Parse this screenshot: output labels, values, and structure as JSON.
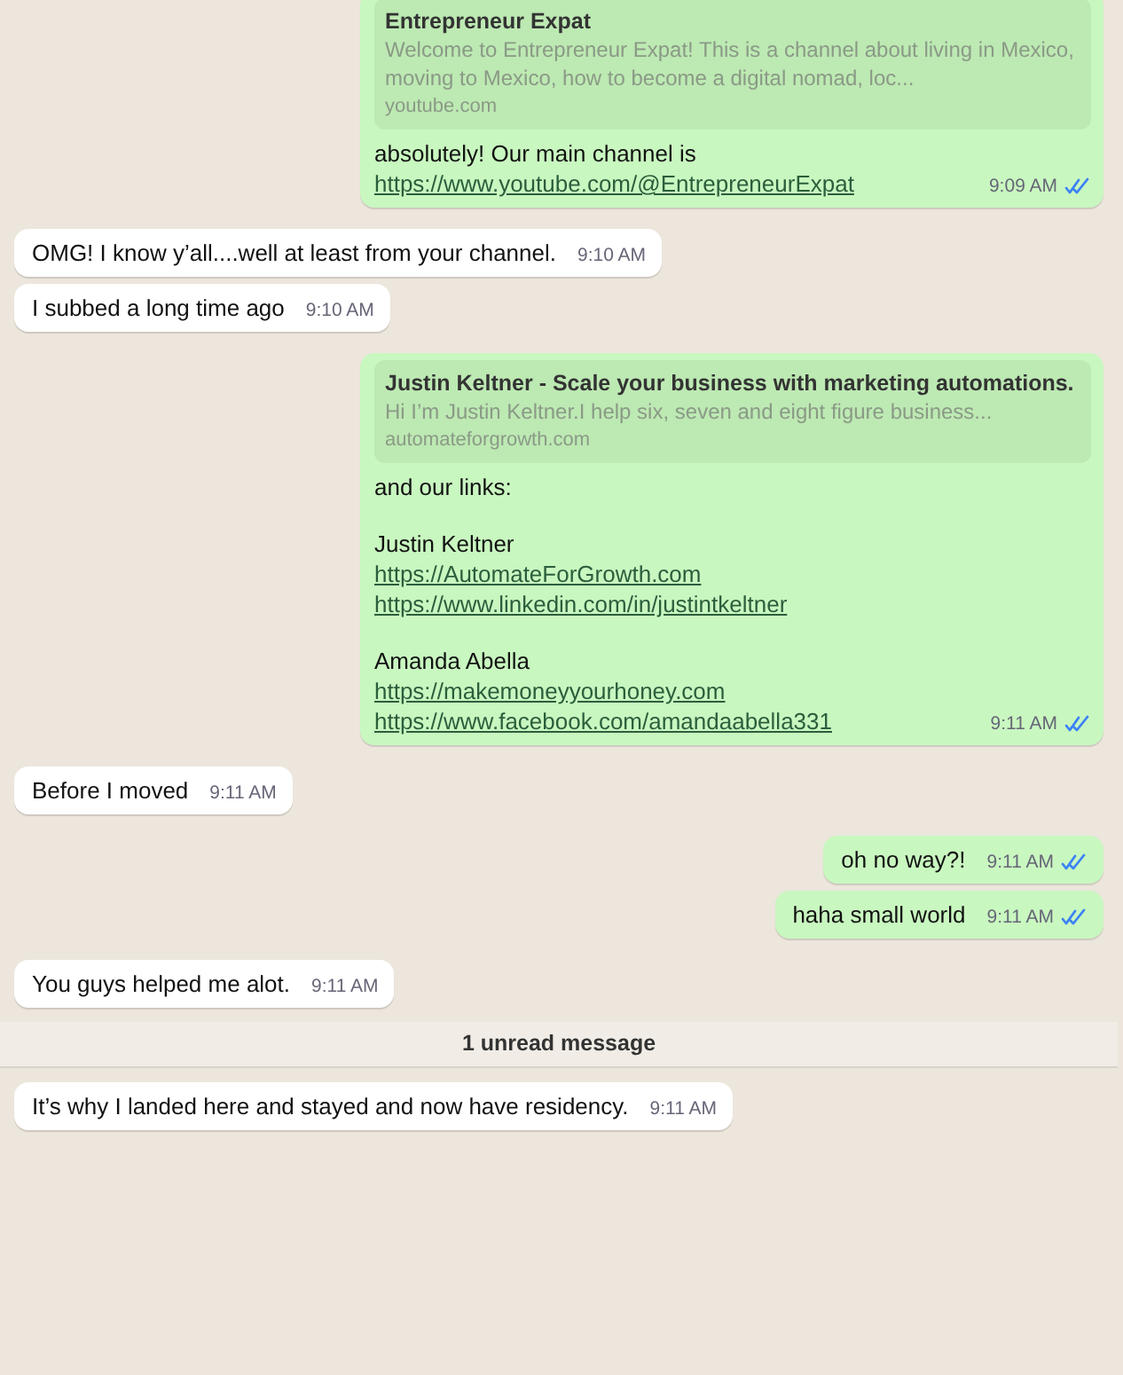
{
  "messages": [
    {
      "kind": "outgoing",
      "preview": {
        "title": "Entrepreneur Expat",
        "description": "Welcome to Entrepreneur Expat! This is a channel about living in Mexico, moving to Mexico, how to become a digital nomad, loc...",
        "domain": "youtube.com"
      },
      "paragraphs": [
        [
          {
            "kind": "text",
            "text": "absolutely! Our main channel is "
          },
          {
            "kind": "link",
            "text": "https://www.youtube.com/@EntrepreneurExpat"
          }
        ]
      ],
      "time": "9:09 AM",
      "read": true
    },
    {
      "kind": "incoming",
      "paragraphs": [
        [
          {
            "kind": "text",
            "text": "OMG! I know y’all....well at least from your channel."
          }
        ]
      ],
      "time": "9:10 AM"
    },
    {
      "kind": "incoming",
      "paragraphs": [
        [
          {
            "kind": "text",
            "text": "I subbed a long time ago"
          }
        ]
      ],
      "time": "9:10 AM"
    },
    {
      "kind": "outgoing",
      "preview": {
        "title": "Justin Keltner - Scale your business with marketing automations.",
        "description": "Hi I’m Justin Keltner.I help six, seven and eight figure business...",
        "domain": "automateforgrowth.com"
      },
      "paragraphs": [
        [
          {
            "kind": "text",
            "text": "and our links:"
          }
        ],
        [
          {
            "kind": "text",
            "text": "Justin Keltner"
          },
          {
            "kind": "link",
            "text": "https://AutomateForGrowth.com"
          },
          {
            "kind": "link",
            "text": "https://www.linkedin.com/in/justintkeltner"
          }
        ],
        [
          {
            "kind": "text",
            "text": "Amanda Abella"
          },
          {
            "kind": "link",
            "text": "https://makemoneyyourhoney.com"
          },
          {
            "kind": "link",
            "text": "https://www.facebook.com/amandaabella331"
          }
        ]
      ],
      "time": "9:11 AM",
      "read": true
    },
    {
      "kind": "incoming",
      "paragraphs": [
        [
          {
            "kind": "text",
            "text": "Before I moved"
          }
        ]
      ],
      "time": "9:11 AM"
    },
    {
      "kind": "outgoing",
      "paragraphs": [
        [
          {
            "kind": "text",
            "text": "oh no way?!"
          }
        ]
      ],
      "time": "9:11 AM",
      "read": true
    },
    {
      "kind": "outgoing",
      "paragraphs": [
        [
          {
            "kind": "text",
            "text": "haha small world"
          }
        ]
      ],
      "time": "9:11 AM",
      "read": true
    },
    {
      "kind": "incoming",
      "paragraphs": [
        [
          {
            "kind": "text",
            "text": "You guys helped me alot."
          }
        ]
      ],
      "time": "9:11 AM"
    },
    {
      "kind": "divider",
      "text": "1 unread message"
    },
    {
      "kind": "incoming",
      "paragraphs": [
        [
          {
            "kind": "text",
            "text": "It’s why I landed here and stayed and now have residency."
          }
        ]
      ],
      "time": "9:11 AM"
    }
  ]
}
